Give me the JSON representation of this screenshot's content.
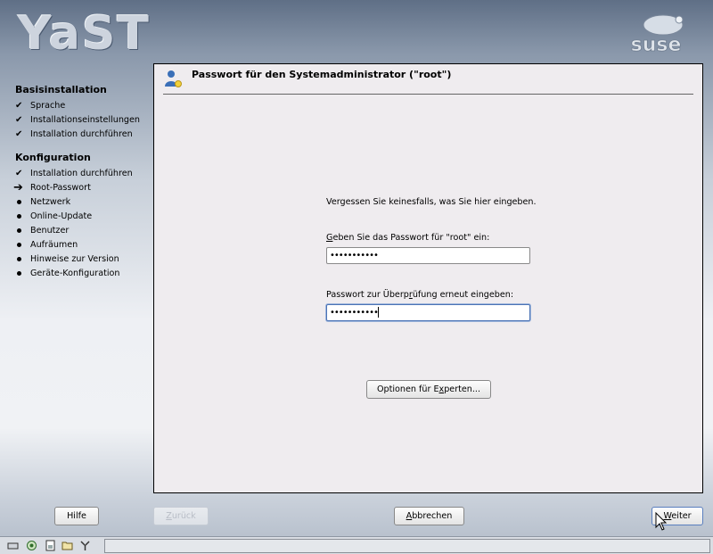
{
  "app": {
    "logo_text": "YaST",
    "brand_text": "suse"
  },
  "sidebar": {
    "sections": [
      {
        "title": "Basisinstallation",
        "steps": [
          {
            "label": "Sprache",
            "state": "done"
          },
          {
            "label": "Installationseinstellungen",
            "state": "done"
          },
          {
            "label": "Installation durchführen",
            "state": "done"
          }
        ]
      },
      {
        "title": "Konfiguration",
        "steps": [
          {
            "label": "Installation durchführen",
            "state": "done"
          },
          {
            "label": "Root-Passwort",
            "state": "current"
          },
          {
            "label": "Netzwerk",
            "state": "pending"
          },
          {
            "label": "Online-Update",
            "state": "pending"
          },
          {
            "label": "Benutzer",
            "state": "pending"
          },
          {
            "label": "Aufräumen",
            "state": "pending"
          },
          {
            "label": "Hinweise zur Version",
            "state": "pending"
          },
          {
            "label": "Geräte-Konfiguration",
            "state": "pending"
          }
        ]
      }
    ]
  },
  "dialog": {
    "title": "Passwort für den Systemadministrator (\"root\")",
    "hint": "Vergessen Sie keinesfalls, was Sie hier eingeben.",
    "password_label_pre": "",
    "password_label_ul": "G",
    "password_label_post": "eben Sie das Passwort für \"root\" ein:",
    "password_value": "•••••••••••",
    "confirm_label_pre": "Passwort zur Überp",
    "confirm_label_ul": "r",
    "confirm_label_post": "üfung erneut eingeben:",
    "confirm_value": "•••••••••••",
    "expert_pre": "Optionen für E",
    "expert_ul": "x",
    "expert_post": "perten..."
  },
  "buttons": {
    "help": "Hilfe",
    "back_ul": "Z",
    "back_post": "urück",
    "abort_ul": "A",
    "abort_post": "bbrechen",
    "next_ul": "W",
    "next_post": "eiter"
  }
}
